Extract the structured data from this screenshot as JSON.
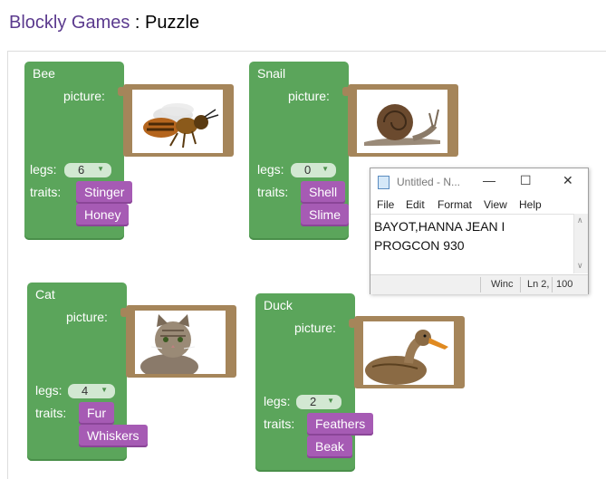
{
  "header": {
    "app_title": "Blockly Games",
    "separator": " : ",
    "page_title": "Puzzle"
  },
  "animals": {
    "bee": {
      "name": "Bee",
      "picture_label": "picture:",
      "legs_label": "legs:",
      "legs": "6",
      "traits_label": "traits:",
      "traits": [
        "Stinger",
        "Honey"
      ]
    },
    "snail": {
      "name": "Snail",
      "picture_label": "picture:",
      "legs_label": "legs:",
      "legs": "0",
      "traits_label": "traits:",
      "traits": [
        "Shell",
        "Slime"
      ]
    },
    "cat": {
      "name": "Cat",
      "picture_label": "picture:",
      "legs_label": "legs:",
      "legs": "4",
      "traits_label": "traits:",
      "traits": [
        "Fur",
        "Whiskers"
      ]
    },
    "duck": {
      "name": "Duck",
      "picture_label": "picture:",
      "legs_label": "legs:",
      "legs": "2",
      "traits_label": "traits:",
      "traits": [
        "Feathers",
        "Beak"
      ]
    }
  },
  "notepad": {
    "title": "Untitled - N...",
    "controls": {
      "minimize": "—",
      "maximize": "☐",
      "close": "✕"
    },
    "menu": [
      "File",
      "Edit",
      "Format",
      "View",
      "Help"
    ],
    "lines": [
      "BAYOT,HANNA JEAN I",
      "PROGCON 930"
    ],
    "status": {
      "encoding": "Winc",
      "position": "Ln 2,",
      "zoom": "100"
    }
  },
  "colors": {
    "block": "#5ba55b",
    "trait": "#a65bb4",
    "picture_frame": "#a5855a",
    "title_accent": "#5b3a8e"
  },
  "icons": {
    "dropdown": "triangle-down-icon",
    "notepad": "notepad-icon"
  }
}
